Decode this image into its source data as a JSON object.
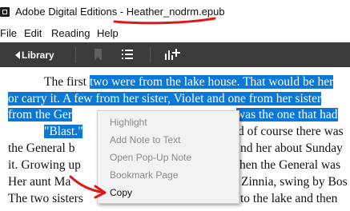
{
  "window": {
    "title": "Adobe Digital Editions - Heather_nodrm.epub"
  },
  "menubar": {
    "items": [
      "File",
      "Edit",
      "Reading",
      "Help"
    ]
  },
  "toolbar": {
    "library_label": "Library"
  },
  "reader": {
    "lines": [
      {
        "plain": "The first ",
        "selected": "two were from the lake house. That would be her"
      },
      {
        "plain": "",
        "selected": "or carry it. A few from her sister, Violet and one from her sister"
      },
      {
        "plain": "",
        "selected": "from the Ger",
        "hidden": "",
        "tail_selected": "was the one that had"
      },
      {
        "plain": "",
        "selected": "\"Blast.\"",
        "tail": "d of course there was"
      },
      {
        "plain": "the General b",
        "tail": "nd her about Sunday"
      },
      {
        "plain": "it. Growing up",
        "tail": "hen the General was"
      },
      {
        "plain": "Her aunt Ma",
        "tail": "Zinnia, swing by Bos"
      },
      {
        "plain": "The two sisters",
        "tail": "to the lake and then"
      }
    ]
  },
  "context_menu": {
    "items": [
      {
        "label": "Highlight",
        "enabled": false
      },
      {
        "label": "Add Note to Text",
        "enabled": false
      },
      {
        "label": "Open Pop-Up Note",
        "enabled": false
      },
      {
        "label": "Bookmark Page",
        "enabled": false
      },
      {
        "label": "Copy",
        "enabled": true
      }
    ]
  },
  "colors": {
    "selection": "#0b78d7",
    "toolbar": "#3b3b3b",
    "annotation": "#e0161b"
  },
  "icons": [
    "app-icon",
    "bookmark-icon",
    "toc-icon",
    "display-options-icon"
  ]
}
